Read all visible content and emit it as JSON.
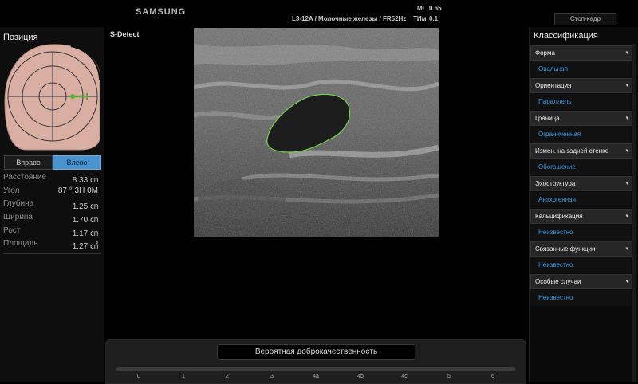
{
  "top": {
    "brand": "SAMSUNG",
    "probe_info": "L3-12A / Молочные железы / FR52Hz",
    "mi_label": "MI",
    "mi_value": "0.65",
    "tim_label": "TИм",
    "tim_value": "0.1",
    "freeze_label": "Стоп-кадр"
  },
  "left_panel": {
    "title": "Позиция",
    "buttons": {
      "right": "Вправо",
      "left": "Влево"
    },
    "active_button": "left",
    "measurements": [
      {
        "label": "Расстояние",
        "value": "8.33 ㎝"
      },
      {
        "label": "Угол",
        "value": "87 ° 3Н 0М"
      },
      {
        "label": "Глубина",
        "value": "1.25 ㎝"
      },
      {
        "label": "Ширина",
        "value": "1.70 ㎝"
      },
      {
        "label": "Рост",
        "value": "1.17 ㎝"
      },
      {
        "label": "Площадь",
        "value": "1.27 ㎠"
      }
    ]
  },
  "center": {
    "mode_label": "S-Detect",
    "result_text": "Вероятная доброкачественность",
    "scale_ticks": [
      "0",
      "1",
      "2",
      "3",
      "4a",
      "4b",
      "4c",
      "5",
      "6"
    ]
  },
  "right_panel": {
    "title": "Классификация",
    "categories": [
      {
        "label": "Форма",
        "value": "Овальная"
      },
      {
        "label": "Ориентация",
        "value": "Параллель"
      },
      {
        "label": "Граница",
        "value": "Ограниченная"
      },
      {
        "label": "Измен. на задней стенке",
        "value": "Обогащение"
      },
      {
        "label": "Эхоструктура",
        "value": "Анэхогенная"
      },
      {
        "label": "Кальцификация",
        "value": "Неизвестно"
      },
      {
        "label": "Связанные функции",
        "value": "Неизвестно"
      },
      {
        "label": "Особые случаи",
        "value": "Неизвестно"
      }
    ]
  },
  "colors": {
    "accent_blue": "#3c9be6",
    "active_button": "#4a93cf",
    "lesion_outline": "#6fd04a",
    "breast_skin": "#d9aea3"
  },
  "icons": [
    "dropdown-arrow-icon",
    "breast-position-diagram-icon"
  ]
}
